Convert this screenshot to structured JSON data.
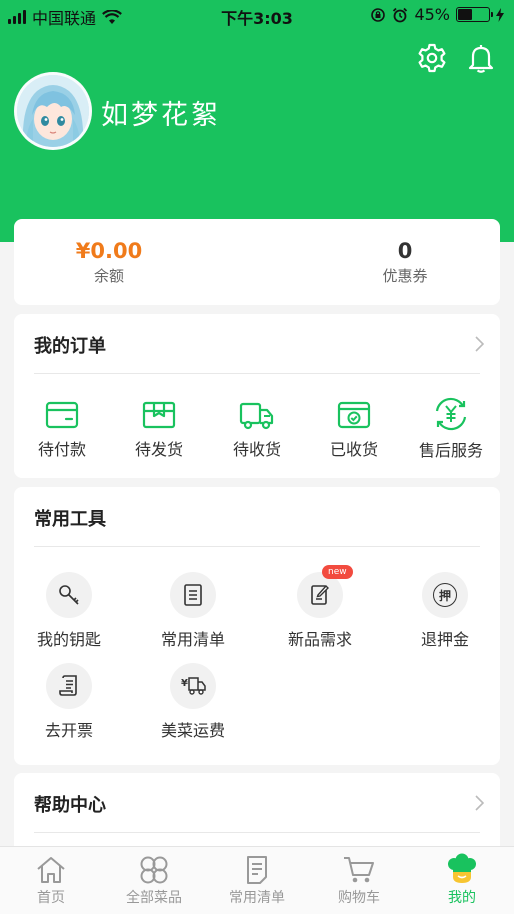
{
  "status_bar": {
    "carrier": "中国联通",
    "time": "下午3:03",
    "battery_text": "45%",
    "battery_level": 0.45
  },
  "header": {
    "username": "如梦花絮",
    "settings_icon": "gear-icon",
    "notification_icon": "bell-icon"
  },
  "wallet": {
    "balance_value": "¥0.00",
    "balance_label": "余额",
    "coupon_value": "0",
    "coupon_label": "优惠券"
  },
  "orders": {
    "title": "我的订单",
    "items": [
      {
        "label": "待付款",
        "icon": "wallet-icon"
      },
      {
        "label": "待发货",
        "icon": "package-icon"
      },
      {
        "label": "待收货",
        "icon": "truck-icon"
      },
      {
        "label": "已收货",
        "icon": "received-box-icon"
      },
      {
        "label": "售后服务",
        "icon": "refund-icon"
      }
    ]
  },
  "tools": {
    "title": "常用工具",
    "items": [
      {
        "label": "我的钥匙",
        "icon": "key-icon"
      },
      {
        "label": "常用清单",
        "icon": "list-icon"
      },
      {
        "label": "新品需求",
        "icon": "edit-icon",
        "badge": "new"
      },
      {
        "label": "退押金",
        "icon": "deposit-icon",
        "glyph": "押"
      },
      {
        "label": "去开票",
        "icon": "invoice-icon"
      },
      {
        "label": "美菜运费",
        "icon": "freight-icon"
      }
    ]
  },
  "help": {
    "title": "帮助中心"
  },
  "tabbar": {
    "items": [
      {
        "label": "首页",
        "icon": "home-icon"
      },
      {
        "label": "全部菜品",
        "icon": "grid-icon"
      },
      {
        "label": "常用清单",
        "icon": "list-icon"
      },
      {
        "label": "购物车",
        "icon": "cart-icon"
      },
      {
        "label": "我的",
        "icon": "chef-hat-icon",
        "active": true
      }
    ]
  },
  "colors": {
    "brand_green": "#19c25e",
    "balance_orange": "#f07b1b",
    "badge_red": "#f24b3f"
  }
}
